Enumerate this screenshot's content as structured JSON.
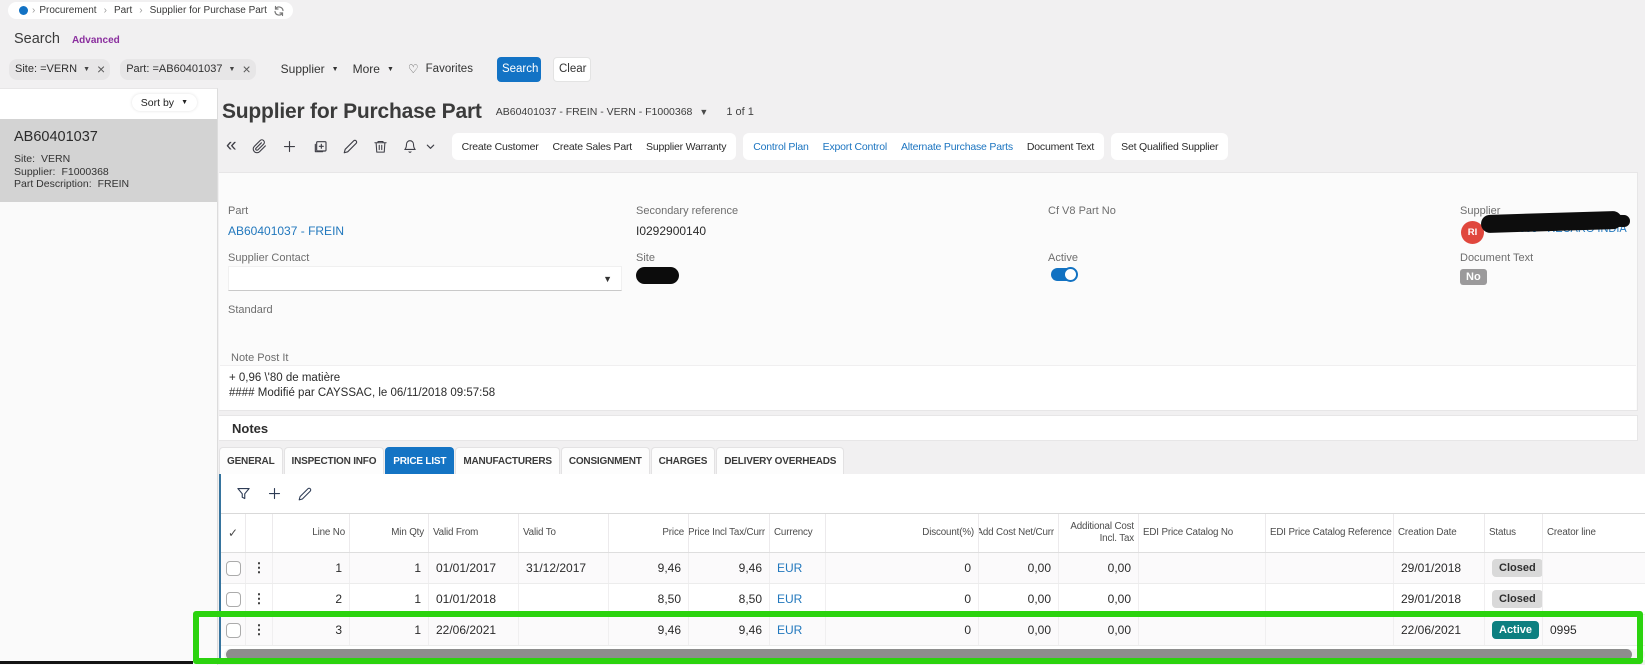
{
  "breadcrumb": {
    "items": [
      "Procurement",
      "Part",
      "Supplier for Purchase Part"
    ]
  },
  "search": {
    "title": "Search",
    "advanced_label": "Advanced",
    "chips": [
      "Site: =VERN",
      "Part: =AB60401037"
    ],
    "dropdowns": [
      "Supplier",
      "More"
    ],
    "favorites_label": "Favorites",
    "search_button": "Search",
    "clear_button": "Clear"
  },
  "sidebar": {
    "sort_by_label": "Sort by",
    "card": {
      "title": "AB60401037",
      "fields": [
        {
          "label": "Site:",
          "value": "VERN"
        },
        {
          "label": "Supplier:",
          "value": "F1000368"
        },
        {
          "label": "Part Description:",
          "value": "FREIN"
        }
      ]
    }
  },
  "header": {
    "title": "Supplier for Purchase Part",
    "record_selector": "AB60401037 - FREIN - VERN - F1000368",
    "record_count": "1 of 1"
  },
  "command_bar": {
    "icon_names": [
      "collapse-left",
      "attachment",
      "add",
      "duplicate",
      "edit",
      "delete",
      "notifications"
    ],
    "groups": [
      {
        "buttons": [
          {
            "label": "Create Customer",
            "style": "default"
          },
          {
            "label": "Create Sales Part",
            "style": "default"
          },
          {
            "label": "Supplier Warranty",
            "style": "default"
          }
        ]
      },
      {
        "buttons": [
          {
            "label": "Control Plan",
            "style": "blue"
          },
          {
            "label": "Export Control",
            "style": "blue"
          },
          {
            "label": "Alternate Purchase Parts",
            "style": "blue"
          },
          {
            "label": "Document Text",
            "style": "default"
          }
        ]
      },
      {
        "buttons": [
          {
            "label": "Set Qualified Supplier",
            "style": "default"
          }
        ]
      }
    ]
  },
  "form": {
    "part": {
      "label": "Part",
      "value": "AB60401037 - FREIN"
    },
    "secondary_reference": {
      "label": "Secondary reference",
      "value": "I0292900140"
    },
    "cf_v8_part_no": {
      "label": "Cf V8 Part No",
      "value": ""
    },
    "supplier": {
      "label": "Supplier",
      "avatar_initials": "RI",
      "value": "F1000368 - RECARO INDIA",
      "redacted": true
    },
    "supplier_contact": {
      "label": "Supplier Contact",
      "value": ""
    },
    "site": {
      "label": "Site",
      "redacted": true
    },
    "active": {
      "label": "Active",
      "value": true
    },
    "document_text": {
      "label": "Document Text",
      "value": "No"
    },
    "standard": {
      "label": "Standard"
    },
    "note_post_it": {
      "label": "Note Post It",
      "lines": [
        "+ 0,96 \\'80 de matière",
        "#### Modifié par CAYSSAC, le 06/11/2018 09:57:58"
      ]
    }
  },
  "notes_section": {
    "label": "Notes"
  },
  "tabs": [
    {
      "label": "GENERAL",
      "active": false
    },
    {
      "label": "INSPECTION INFO",
      "active": false
    },
    {
      "label": "PRICE LIST",
      "active": true
    },
    {
      "label": "MANUFACTURERS",
      "active": false
    },
    {
      "label": "CONSIGNMENT",
      "active": false
    },
    {
      "label": "CHARGES",
      "active": false
    },
    {
      "label": "DELIVERY OVERHEADS",
      "active": false
    }
  ],
  "table": {
    "toolbar_icon_names": [
      "filter",
      "add",
      "edit"
    ],
    "columns": [
      {
        "label": "",
        "align": "center",
        "kind": "select"
      },
      {
        "label": "",
        "align": "center",
        "kind": "menu"
      },
      {
        "label": "Line No",
        "align": "right"
      },
      {
        "label": "Min Qty",
        "align": "right"
      },
      {
        "label": "Valid From",
        "align": "left"
      },
      {
        "label": "Valid To",
        "align": "left"
      },
      {
        "label": "Price",
        "align": "right"
      },
      {
        "label": "Price Incl Tax/Curr",
        "align": "right"
      },
      {
        "label": "Currency",
        "align": "left"
      },
      {
        "label": "Discount(%)",
        "align": "right"
      },
      {
        "label": "Add Cost Net/Curr",
        "align": "right"
      },
      {
        "label": "Additional Cost Incl. Tax",
        "align": "right"
      },
      {
        "label": "EDI Price Catalog No",
        "align": "left"
      },
      {
        "label": "EDI Price Catalog Reference",
        "align": "left"
      },
      {
        "label": "Creation Date",
        "align": "left"
      },
      {
        "label": "Status",
        "align": "left"
      },
      {
        "label": "Creator line",
        "align": "left"
      }
    ],
    "rows": [
      {
        "cells": [
          "",
          "",
          "1",
          "1",
          "01/01/2017",
          "31/12/2017",
          "9,46",
          "9,46",
          "EUR",
          "0",
          "0,00",
          "0,00",
          "",
          "",
          "29/01/2018",
          "Closed",
          ""
        ],
        "status_style": "gray"
      },
      {
        "cells": [
          "",
          "",
          "2",
          "1",
          "01/01/2018",
          "",
          "8,50",
          "8,50",
          "EUR",
          "0",
          "0,00",
          "0,00",
          "",
          "",
          "29/01/2018",
          "Closed",
          ""
        ],
        "status_style": "gray"
      },
      {
        "cells": [
          "",
          "",
          "3",
          "1",
          "22/06/2021",
          "",
          "9,46",
          "9,46",
          "EUR",
          "0",
          "0,00",
          "0,00",
          "",
          "",
          "22/06/2021",
          "Active",
          "0995"
        ],
        "status_style": "teal"
      }
    ]
  },
  "annotation": {
    "highlight_color": "#2bd30e"
  }
}
